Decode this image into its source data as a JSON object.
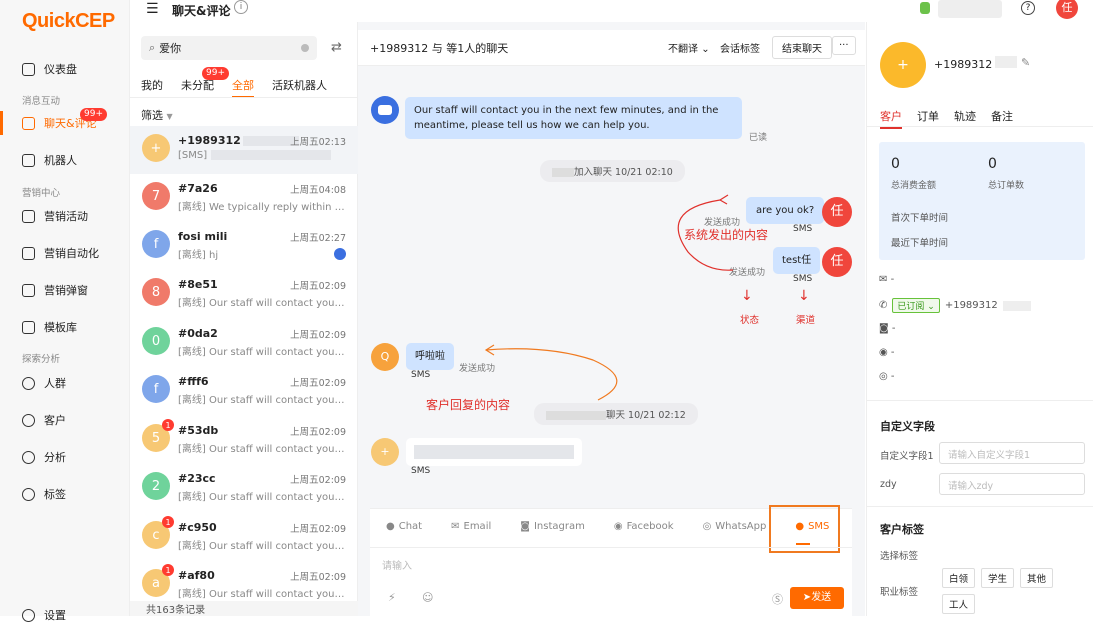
{
  "nav": {
    "logo": "QuickCEP",
    "items": [
      {
        "label": "仪表盘"
      },
      {
        "section": "消息互动"
      },
      {
        "label": "聊天&评论",
        "badge": "99+"
      },
      {
        "label": "机器人"
      },
      {
        "section": "营销中心"
      },
      {
        "label": "营销活动"
      },
      {
        "label": "营销自动化"
      },
      {
        "label": "营销弹窗"
      },
      {
        "label": "模板库"
      },
      {
        "section": "探索分析"
      },
      {
        "label": "人群"
      },
      {
        "label": "客户"
      },
      {
        "label": "分析"
      },
      {
        "label": "标签"
      },
      {
        "label": "设置"
      }
    ]
  },
  "header": {
    "title": "聊天&评论",
    "user_avatar": "任"
  },
  "list": {
    "search_value": "爱你",
    "tabs": [
      {
        "label": "我的"
      },
      {
        "label": "未分配",
        "badge": "99+"
      },
      {
        "label": "全部"
      },
      {
        "label": "活跃机器人"
      }
    ],
    "filter_label": "筛选",
    "footer": "共163条记录",
    "conversations": [
      {
        "name": "+1989312",
        "time": "上周五02:13",
        "preview": "[SMS]",
        "avatar": "+",
        "color": "#f7c874"
      },
      {
        "name": "#7a26",
        "time": "上周五04:08",
        "preview": "[离线] We typically reply within a f...",
        "avatar": "7",
        "color": "#f07a6a"
      },
      {
        "name": "fosi mili",
        "time": "上周五02:27",
        "preview": "[离线] hj",
        "avatar": "f",
        "color": "#7fa6ea"
      },
      {
        "name": "#8e51",
        "time": "上周五02:09",
        "preview": "[离线] Our staff will contact you in...",
        "avatar": "8",
        "color": "#f07a6a"
      },
      {
        "name": "#0da2",
        "time": "上周五02:09",
        "preview": "[离线] Our staff will contact you in...",
        "avatar": "0",
        "color": "#6fd39b"
      },
      {
        "name": "#fff6",
        "time": "上周五02:09",
        "preview": "[离线] Our staff will contact you in...",
        "avatar": "f",
        "color": "#7fa6ea"
      },
      {
        "name": "#53db",
        "time": "上周五02:09",
        "preview": "[离线] Our staff will contact you in...",
        "avatar": "5",
        "color": "#f7c874",
        "unread": "1"
      },
      {
        "name": "#23cc",
        "time": "上周五02:09",
        "preview": "[离线] Our staff will contact you in...",
        "avatar": "2",
        "color": "#6fd39b"
      },
      {
        "name": "#c950",
        "time": "上周五02:09",
        "preview": "[离线] Our staff will contact you in...",
        "avatar": "c",
        "color": "#f7c874",
        "unread": "1"
      },
      {
        "name": "#af80",
        "time": "上周五02:09",
        "preview": "[离线] Our staff will contact you in...",
        "avatar": "a",
        "color": "#f7c874",
        "unread": "1"
      }
    ]
  },
  "chat": {
    "title": "+1989312 与 等1人的聊天",
    "translate": "不翻译",
    "session_tag": "会话标签",
    "end_button": "结束聊天",
    "more": "···",
    "bot_message": "Our staff will contact you in the next few minutes, and in the meantime, please tell us how we can help you.",
    "read_status": "已读",
    "join_notice": "加入聊天  10/21 02:10",
    "msg1": "are you ok?",
    "msg2": "test任",
    "channel": "SMS",
    "sent_status": "发送成功",
    "annotation_system": "系统发出的内容",
    "annotation_state": "状态",
    "annotation_channel": "渠道",
    "customer_msg": "呼啦啦",
    "customer_avatar": "Q",
    "annotation_customer": "客户回复的内容",
    "chat_notice": "聊天  10/21 02:12",
    "agent_avatar": "任",
    "last_avatar": "+"
  },
  "composer": {
    "tabs": [
      {
        "label": "Chat"
      },
      {
        "label": "Email"
      },
      {
        "label": "Instagram"
      },
      {
        "label": "Facebook"
      },
      {
        "label": "WhatsApp"
      },
      {
        "label": "SMS"
      }
    ],
    "placeholder": "请输入",
    "send": "发送"
  },
  "profile": {
    "phone": "+1989312",
    "avatar": "+",
    "tabs": [
      {
        "label": "客户"
      },
      {
        "label": "订单"
      },
      {
        "label": "轨迹"
      },
      {
        "label": "备注"
      }
    ],
    "total_spent_value": "0",
    "total_spent_label": "总消费金额",
    "total_orders_value": "0",
    "total_orders_label": "总订单数",
    "first_order": "首次下单时间",
    "last_order": "最近下单时间",
    "email": "-",
    "subscribed": "已订阅",
    "phone2": "+1989312",
    "ig": "-",
    "fb": "-",
    "wa": "-",
    "custom_title": "自定义字段",
    "custom1_label": "自定义字段1",
    "custom1_placeholder": "请输入自定义字段1",
    "zdy_label": "zdy",
    "zdy_placeholder": "请输入zdy",
    "tag_title": "客户标签",
    "select_tag": "选择标签",
    "job_tag": "职业标签",
    "tags": [
      "白领",
      "学生",
      "其他",
      "工人"
    ]
  },
  "colors": {
    "brand": "#ff6a00",
    "accent_red": "#e0312c",
    "bubble_blue": "#cfe3ff"
  }
}
